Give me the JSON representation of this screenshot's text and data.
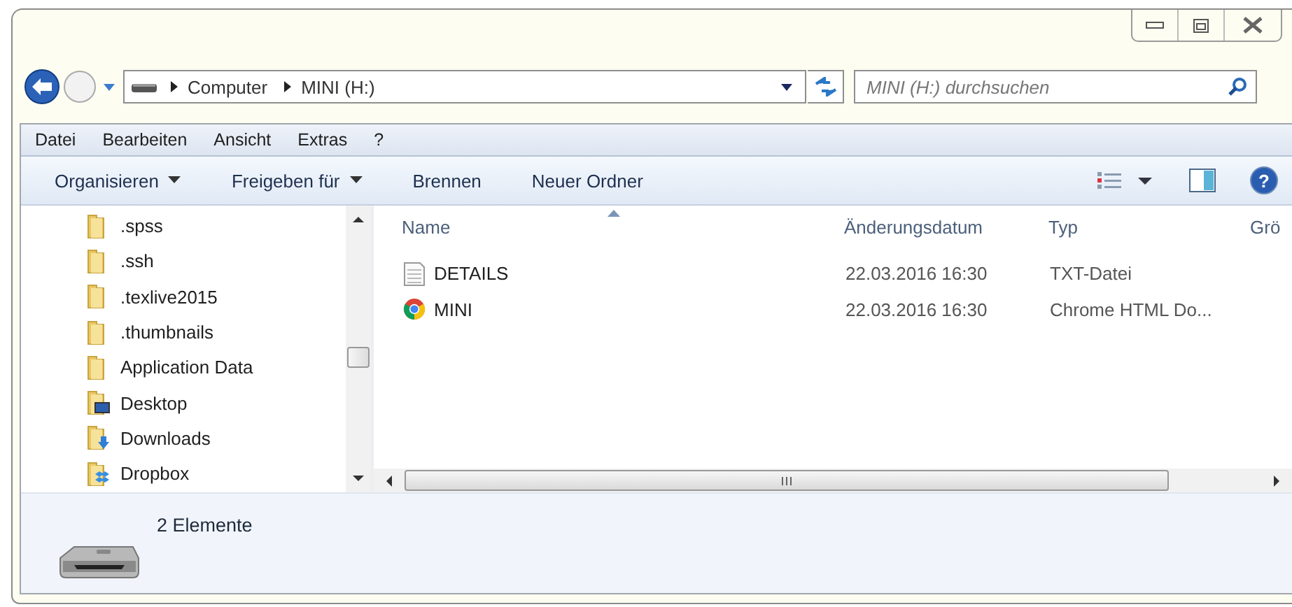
{
  "navigation": {
    "breadcrumb": [
      "Computer",
      "MINI (H:)"
    ],
    "search": {
      "placeholder": "MINI (H:) durchsuchen"
    }
  },
  "menu": [
    "Datei",
    "Bearbeiten",
    "Ansicht",
    "Extras",
    "?"
  ],
  "toolbar": [
    {
      "label": "Organisieren",
      "dropdown": true
    },
    {
      "label": "Freigeben für",
      "dropdown": true
    },
    {
      "label": "Brennen",
      "dropdown": false
    },
    {
      "label": "Neuer Ordner",
      "dropdown": false
    }
  ],
  "help_button": "?",
  "sidebar": {
    "items": [
      {
        "label": ".spss",
        "kind": "folder"
      },
      {
        "label": ".ssh",
        "kind": "folder"
      },
      {
        "label": ".texlive2015",
        "kind": "folder"
      },
      {
        "label": ".thumbnails",
        "kind": "folder"
      },
      {
        "label": "Application Data",
        "kind": "folder"
      },
      {
        "label": "Desktop",
        "kind": "desktop"
      },
      {
        "label": "Downloads",
        "kind": "downloads"
      },
      {
        "label": "Dropbox",
        "kind": "dropbox"
      }
    ]
  },
  "table": {
    "columns": [
      "Name",
      "Änderungsdatum",
      "Typ",
      "Grö"
    ],
    "rows": [
      {
        "kind": "text",
        "name": "DETAILS",
        "modified": "22.03.2016 16:30",
        "type": "TXT-Datei"
      },
      {
        "kind": "chrome",
        "name": "MINI",
        "modified": "22.03.2016 16:30",
        "type": "Chrome HTML Do..."
      }
    ]
  },
  "status_bar": {
    "text": "2 Elemente"
  }
}
